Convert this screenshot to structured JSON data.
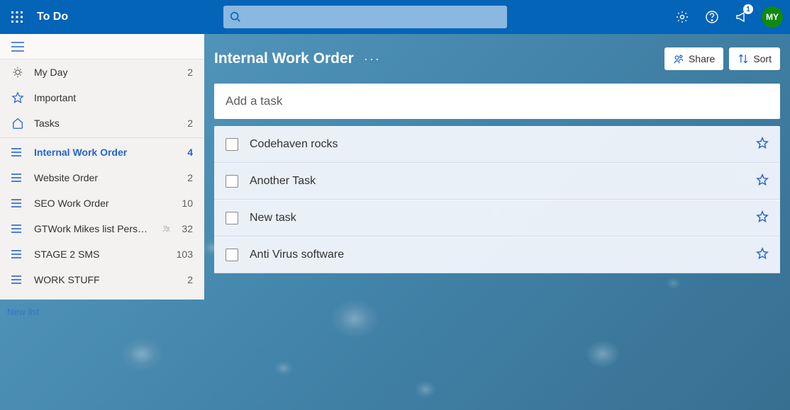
{
  "header": {
    "app_title": "To Do",
    "search_placeholder": "",
    "notification_count": "1",
    "avatar_initials": "MY"
  },
  "sidebar": {
    "smart_lists": [
      {
        "icon": "sun",
        "label": "My Day",
        "count": "2"
      },
      {
        "icon": "star",
        "label": "Important",
        "count": ""
      },
      {
        "icon": "home",
        "label": "Tasks",
        "count": "2"
      }
    ],
    "custom_lists": [
      {
        "label": "Internal Work Order",
        "count": "4",
        "active": true,
        "shared": false
      },
      {
        "label": "Website Order",
        "count": "2",
        "active": false,
        "shared": false
      },
      {
        "label": "SEO Work Order",
        "count": "10",
        "active": false,
        "shared": false
      },
      {
        "label": "GTWork Mikes list Personal",
        "count": "32",
        "active": false,
        "shared": true
      },
      {
        "label": "STAGE 2 SMS",
        "count": "103",
        "active": false,
        "shared": false
      },
      {
        "label": "WORK STUFF",
        "count": "2",
        "active": false,
        "shared": false
      }
    ],
    "new_list_label": "New list"
  },
  "main": {
    "list_title": "Internal Work Order",
    "share_label": "Share",
    "sort_label": "Sort",
    "add_task_placeholder": "Add a task",
    "tasks": [
      {
        "title": "Codehaven rocks"
      },
      {
        "title": "Another Task"
      },
      {
        "title": "New task"
      },
      {
        "title": "Anti Virus software"
      }
    ]
  }
}
